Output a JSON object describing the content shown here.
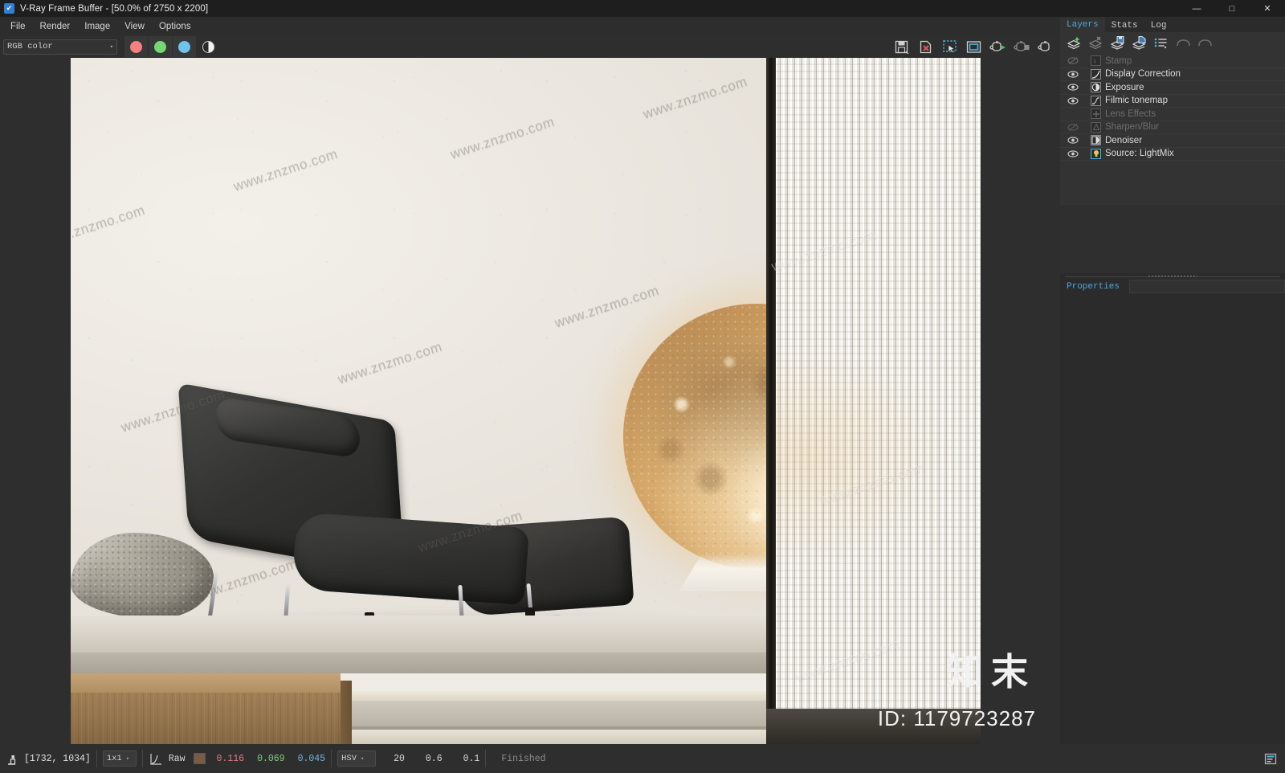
{
  "window": {
    "title": "V-Ray Frame Buffer - [50.0% of 2750 x 2200]",
    "app_icon": "vray-checkbox-icon",
    "minimize": "—",
    "maximize": "□",
    "close": "✕"
  },
  "menubar": {
    "items": [
      {
        "label": "File"
      },
      {
        "label": "Render"
      },
      {
        "label": "Image"
      },
      {
        "label": "View"
      },
      {
        "label": "Options"
      }
    ]
  },
  "toolbar": {
    "channel_select": {
      "value": "RGB color",
      "arrow": "▾"
    },
    "channel_buttons": [
      {
        "name": "red-channel-button",
        "color": "#f4807f"
      },
      {
        "name": "green-channel-button",
        "color": "#74d973"
      },
      {
        "name": "blue-channel-button",
        "color": "#6ec4ef"
      },
      {
        "name": "alpha-mono-button",
        "color": "#f2f2f2"
      }
    ],
    "right_icons": [
      {
        "name": "save-image-icon",
        "title": "Save image"
      },
      {
        "name": "clear-image-icon",
        "title": "Clear image"
      },
      {
        "name": "region-render-icon",
        "title": "Render region"
      },
      {
        "name": "render-window-icon",
        "title": "Render window"
      },
      {
        "name": "start-render-icon",
        "title": "Start render"
      },
      {
        "name": "stop-render-icon",
        "title": "Stop render"
      },
      {
        "name": "render-last-icon",
        "title": "Render last"
      }
    ]
  },
  "layers_panel": {
    "tabs": [
      {
        "label": "Layers",
        "active": true
      },
      {
        "label": "Stats",
        "active": false
      },
      {
        "label": "Log",
        "active": false
      }
    ],
    "toolbar_icons": [
      {
        "name": "add-layer-icon"
      },
      {
        "name": "delete-layer-icon"
      },
      {
        "name": "save-layers-icon"
      },
      {
        "name": "load-layers-icon"
      },
      {
        "name": "layer-presets-icon"
      },
      {
        "name": "undo-icon"
      },
      {
        "name": "redo-icon"
      }
    ],
    "layers": [
      {
        "label": "Stamp",
        "icon": "stamp-icon",
        "enabled": false,
        "visible": false
      },
      {
        "label": "Display Correction",
        "icon": "curve-icon",
        "enabled": true,
        "visible": true
      },
      {
        "label": "Exposure",
        "icon": "exposure-icon",
        "enabled": true,
        "visible": true
      },
      {
        "label": "Filmic tonemap",
        "icon": "filmic-tonemap-icon",
        "enabled": true,
        "visible": true
      },
      {
        "label": "Lens Effects",
        "icon": "lens-effects-icon",
        "enabled": false,
        "visible": false
      },
      {
        "label": "Sharpen/Blur",
        "icon": "sharpen-blur-icon",
        "enabled": false,
        "visible": false
      },
      {
        "label": "Denoiser",
        "icon": "denoiser-icon",
        "enabled": true,
        "visible": true
      },
      {
        "label": "Source: LightMix",
        "icon": "lightmix-icon",
        "enabled": true,
        "visible": true
      }
    ],
    "properties": {
      "tab_label": "Properties",
      "value": ""
    }
  },
  "statusbar": {
    "pixel_lock_icon": "pixel-lock-icon",
    "coordinates": "[1732, 1034]",
    "sample_size": {
      "value": "1x1",
      "arrow": "▾"
    },
    "curve_icon": "tone-curve-icon",
    "raw_label": "Raw",
    "color_swatch": "#7a5b45",
    "r": "0.116",
    "g": "0.069",
    "b": "0.045",
    "color_space": {
      "value": "HSV",
      "arrow": "▾"
    },
    "num1": "20",
    "num2": "0.6",
    "num3": "0.1",
    "status": "Finished",
    "panel_toggle_icon": "toggle-panel-icon"
  },
  "image": {
    "watermarks": [
      "www.znzmo.com",
      "www.znzmo.com",
      "www.znzmo.com",
      "www.znzmo.com",
      "www.znzmo.com",
      "www.znzmo.com",
      "www.znzmo.com",
      "www.znzmo.com",
      "www.znzmo.com",
      "www.znzmo.com",
      "www.znzmo.com",
      "www.znzmo.com"
    ],
    "brand": "知末",
    "brand_id": "ID: 1179723287"
  }
}
